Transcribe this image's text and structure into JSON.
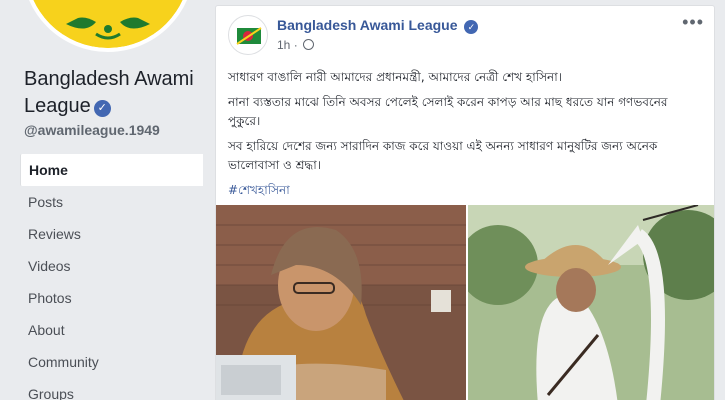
{
  "page": {
    "name": "Bangladesh Awami League",
    "handle": "@awamileague.1949"
  },
  "nav": [
    {
      "label": "Home",
      "active": true
    },
    {
      "label": "Posts"
    },
    {
      "label": "Reviews"
    },
    {
      "label": "Videos"
    },
    {
      "label": "Photos"
    },
    {
      "label": "About"
    },
    {
      "label": "Community"
    },
    {
      "label": "Groups"
    }
  ],
  "post": {
    "author": "Bangladesh Awami League",
    "time": "1h",
    "paragraphs": [
      "সাধারণ বাঙালি নারী আমাদের প্রধানমন্ত্রী, আমাদের নেত্রী শেখ হাসিনা।",
      "নানা ব্যস্ততার মাঝে তিনি অবসর পেলেই সেলাই করেন কাপড় আর মাছ ধরতে যান গণভবনের পুকুরে।",
      "সব হারিয়ে দেশের জন্য সারাদিন কাজ করে যাওয়া এই অনন্য সাধারণ মানুষটির জন্য অনেক ভালোবাসা ও শ্রদ্ধা।"
    ],
    "hashtag": "#শেখহাসিনা"
  },
  "colors": {
    "link": "#385898",
    "verified": "#4267b2",
    "background": "#e9ebee"
  },
  "icons": {
    "verified": "verified-badge-icon",
    "globe": "globe-icon",
    "more": "more-options-icon"
  }
}
